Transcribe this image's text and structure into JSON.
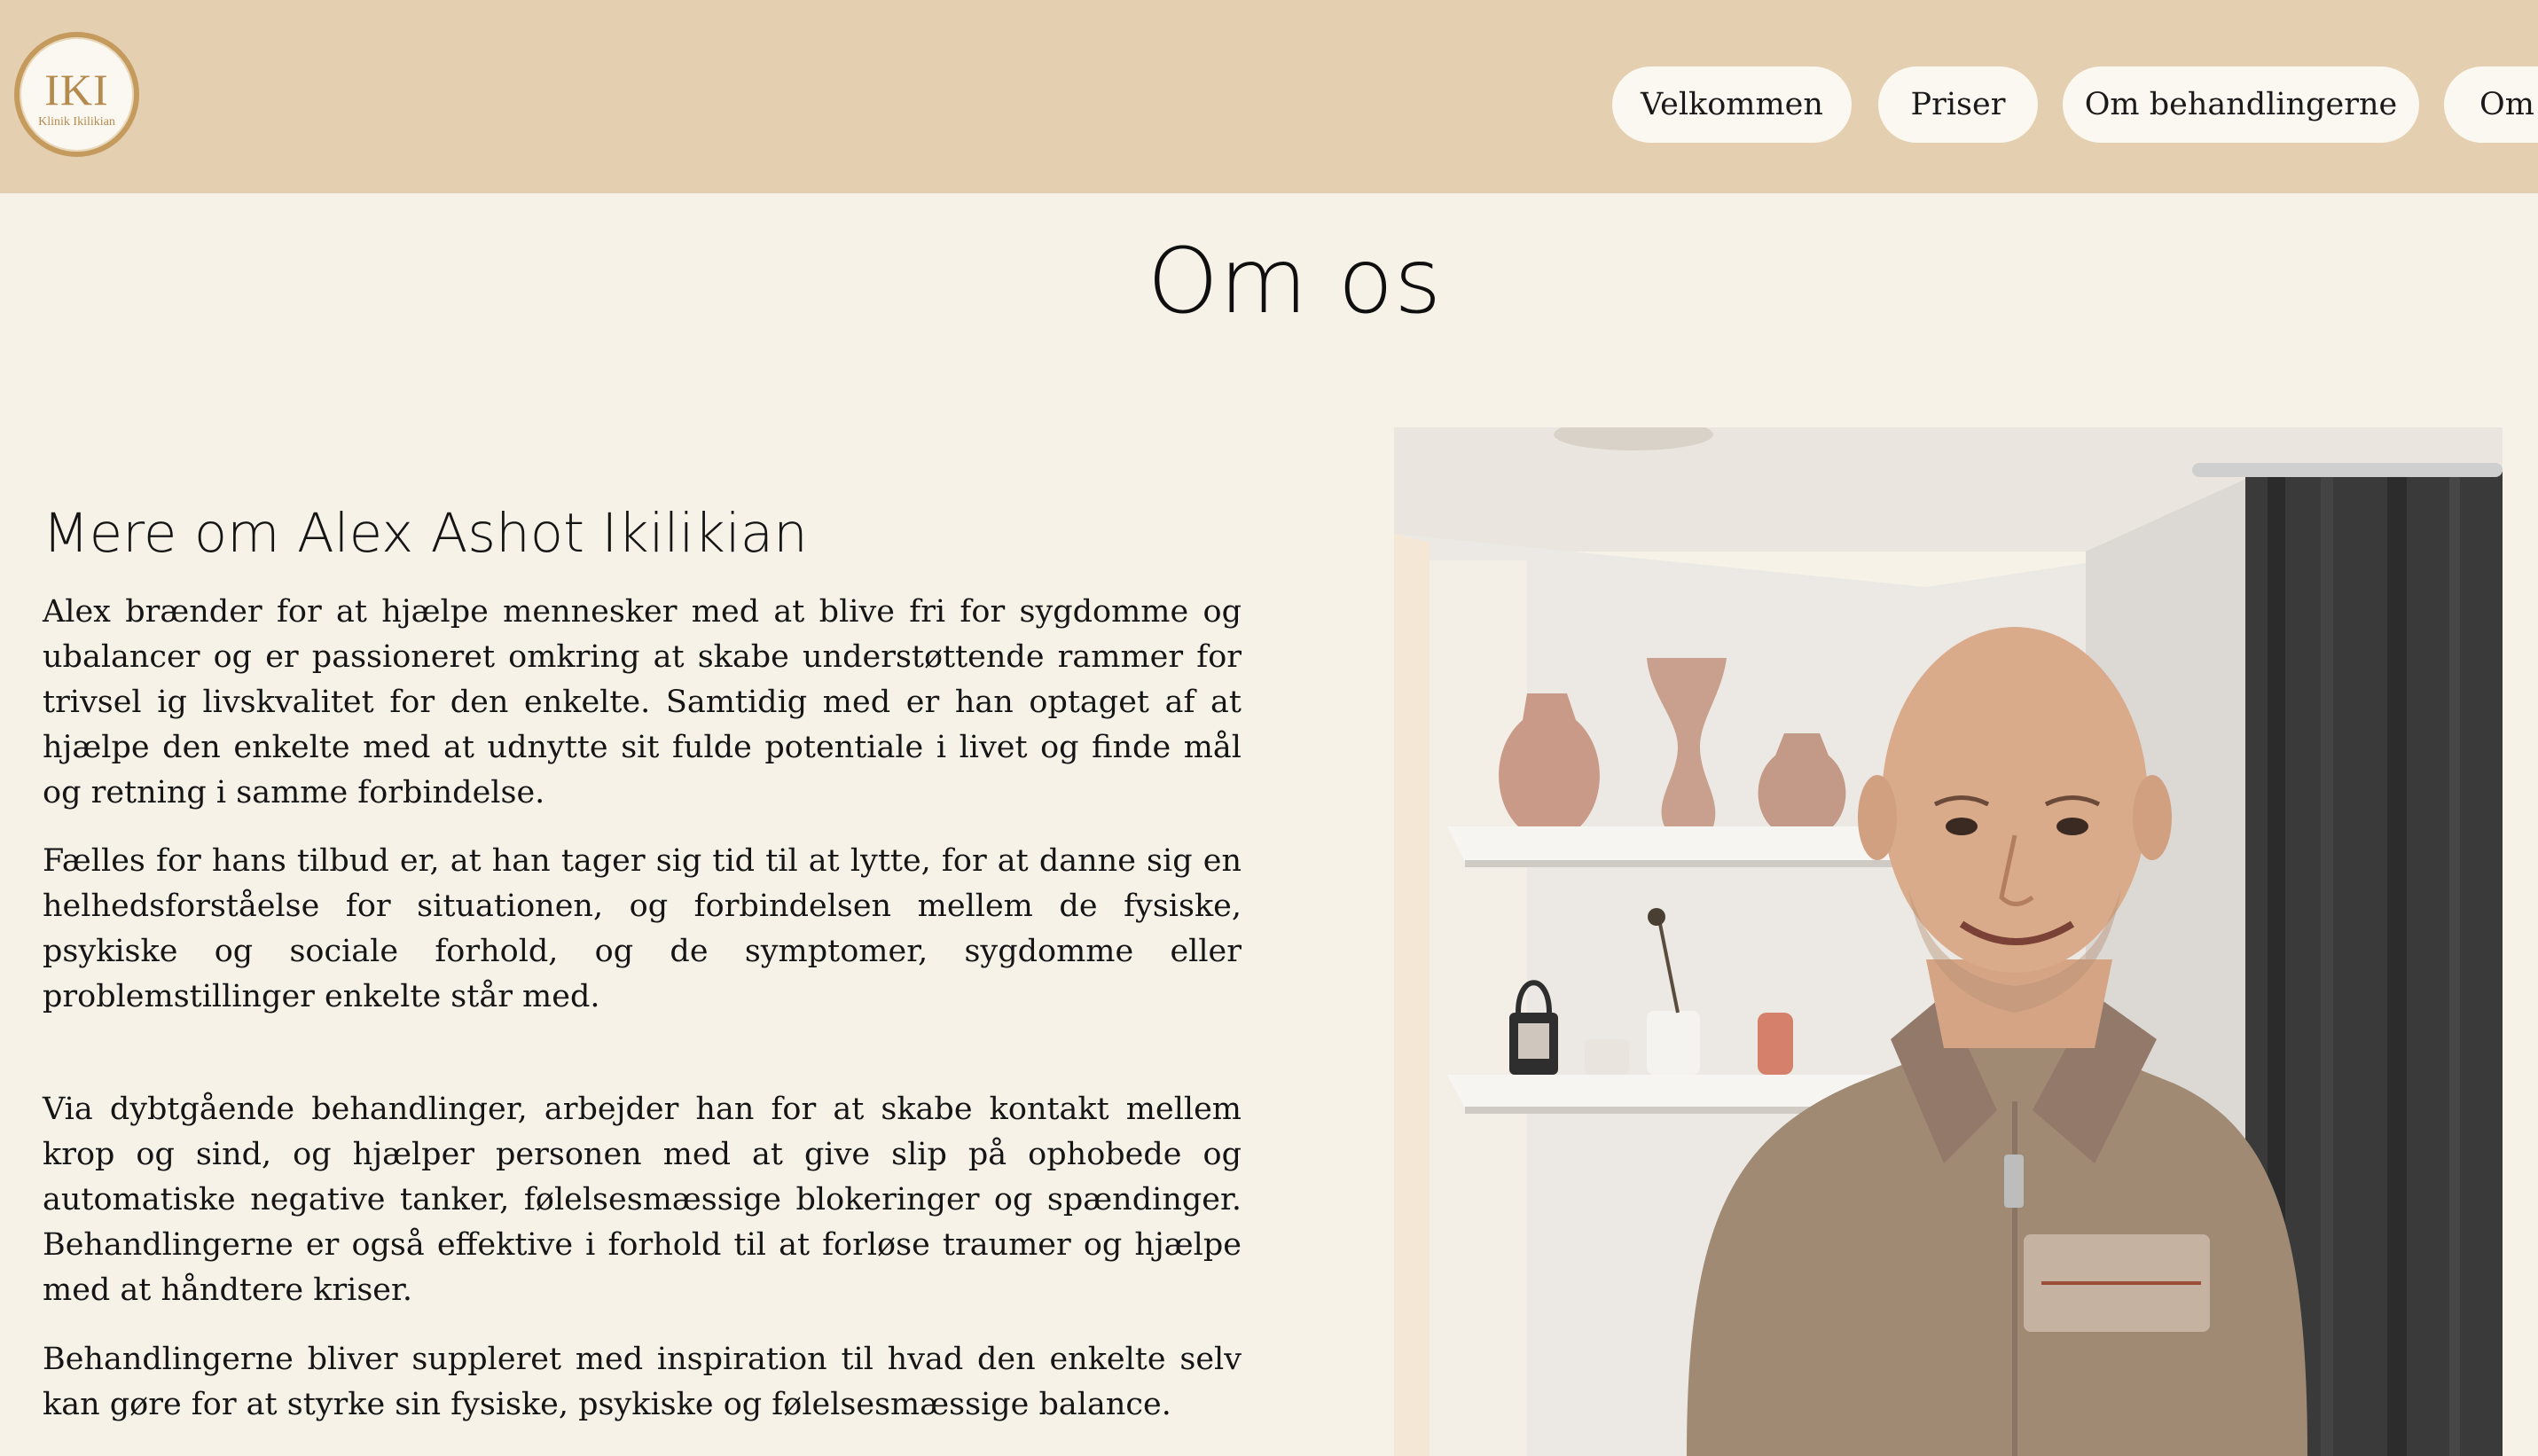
{
  "header": {
    "logo": {
      "mark": "IKI",
      "subtitle": "Klinik Ikilikian"
    },
    "nav": [
      {
        "label": "Velkommen"
      },
      {
        "label": "Priser"
      },
      {
        "label": "Om behandlingerne"
      },
      {
        "label": "Om"
      }
    ]
  },
  "main": {
    "title": "Om os",
    "subheading": "Mere om Alex Ashot Ikilikian",
    "paragraphs": [
      "Alex brænder for at hjælpe mennesker med at blive fri for sygdomme og ubalancer og er passioneret omkring at skabe understøttende rammer for trivsel ig livskvalitet for den enkelte. Samtidig med er han optaget af at hjælpe den enkelte med at udnytte sit fulde potentiale i livet og finde mål og retning i samme forbindelse.",
      "Fælles for hans tilbud er, at han tager sig tid til at lytte, for at danne sig en helhedsforståelse for situationen, og forbindelsen mellem de fysiske, psykiske og sociale forhold, og de symptomer, sygdomme eller problemstillinger enkelte står med.",
      "Via dybtgående behandlinger, arbejder han for at skabe kontakt mellem krop og sind, og hjælper personen med at give slip på ophobede og automatiske negative tanker, følelsesmæssige blokeringer og spændinger. Behandlingerne er også effektive i forhold til at forløse traumer og hjælpe med at håndtere kriser.",
      "Behandlingerne bliver suppleret med inspiration til hvad den enkelte selv kan gøre for at styrke sin fysiske, psykiske og følelsesmæssige balance."
    ]
  },
  "colors": {
    "header_bg": "#e4cfb1",
    "page_bg": "#f6f2e8",
    "button_bg": "#fbf8f1",
    "logo_gold": "#c49a5d"
  }
}
